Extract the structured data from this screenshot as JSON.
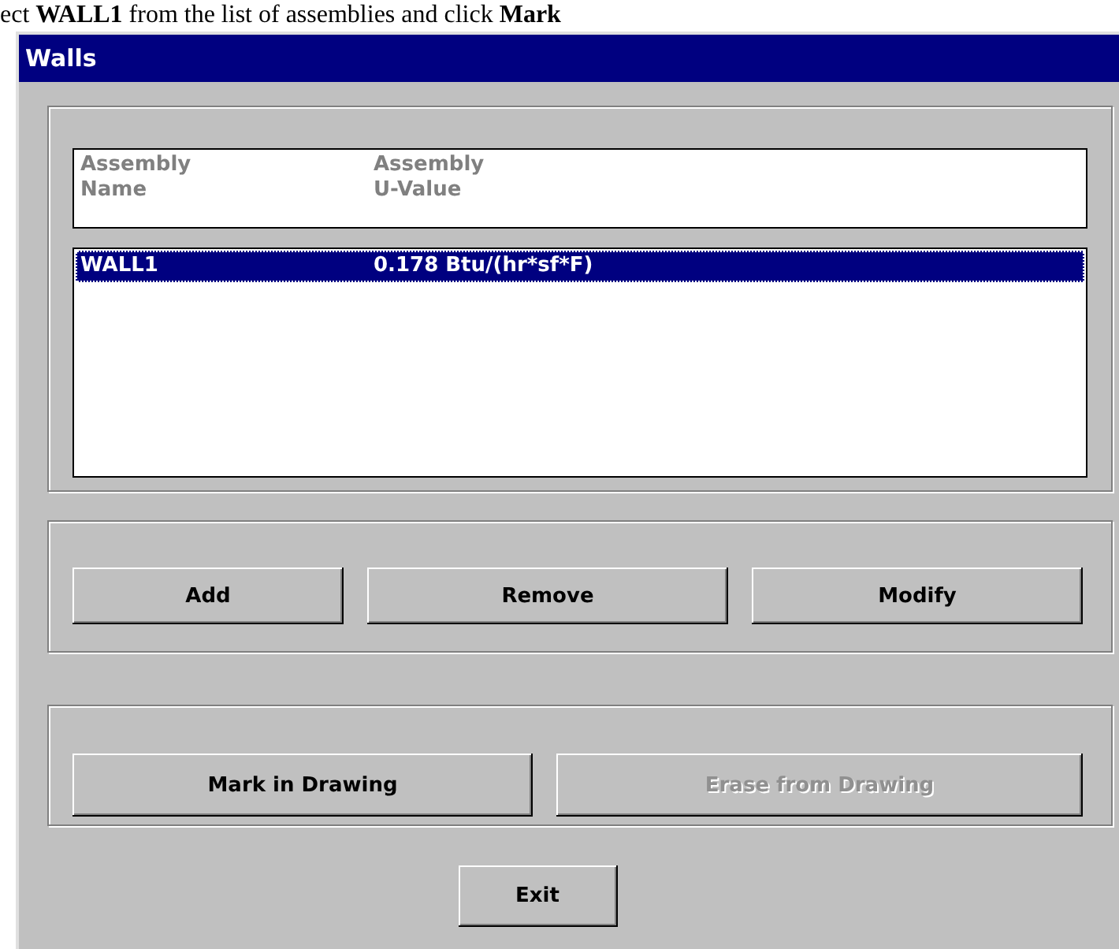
{
  "caption": "ect **WALL1** from the list of assemblies and click **Mark**",
  "window": {
    "title": "Walls"
  },
  "list": {
    "columns": [
      {
        "label": "Assembly\nName"
      },
      {
        "label": "Assembly\nU-Value"
      }
    ],
    "rows": [
      {
        "name": "WALL1",
        "u_value": "0.178 Btu/(hr*sf*F)",
        "selected": true
      }
    ]
  },
  "edit_buttons": [
    {
      "label": "Add",
      "disabled": false
    },
    {
      "label": "Remove",
      "disabled": false
    },
    {
      "label": "Modify",
      "disabled": false
    }
  ],
  "drawing_buttons": [
    {
      "label": "Mark in Drawing",
      "disabled": false
    },
    {
      "label": "Erase from Drawing",
      "disabled": true
    }
  ],
  "exit_button": {
    "label": "Exit"
  }
}
